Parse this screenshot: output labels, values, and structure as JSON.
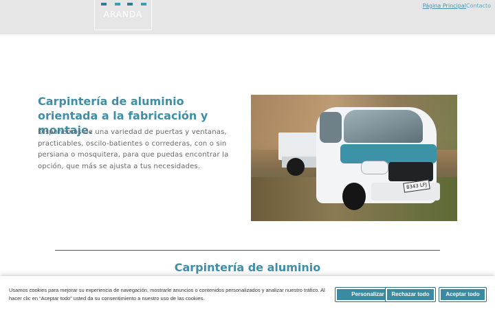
{
  "header": {
    "logo_text": "ARANDA",
    "logo_mark_colors": [
      "#2a7d93",
      "#3a9fb5",
      "#2a7d93",
      "#3a9fb5"
    ],
    "nav": [
      {
        "label": "Página Principal"
      },
      {
        "label": "Contacto"
      }
    ]
  },
  "hero": {
    "title": "Carpintería de aluminio orientada a la fabricación y montaje.",
    "text": "Disponemos de una variedad de puertas y ventanas, practicables, oscilo-batientes o correderas, con o sin persiana o mosquitera, para que puedas encontrar la opción, que más se ajusta a tus necesidades.",
    "image_plate": "8343 LFJ"
  },
  "section": {
    "title": "Carpintería de aluminio"
  },
  "cookie_banner": {
    "text": "Usamos cookies para mejorar su experiencia de navegación, mostrarle anuncios o contenidos personalizados y analizar nuestro tráfico. Al hacer clic en “Aceptar todo” usted da su consentimiento a nuestro uso de las cookies.",
    "buttons": {
      "customize": "Personalizar",
      "reject": "Rechazar todo",
      "accept": "Aceptar todo"
    }
  },
  "colors": {
    "accent": "#3f8ea8",
    "topbar": "#e6e6e6",
    "button": "#3a8aa3"
  }
}
